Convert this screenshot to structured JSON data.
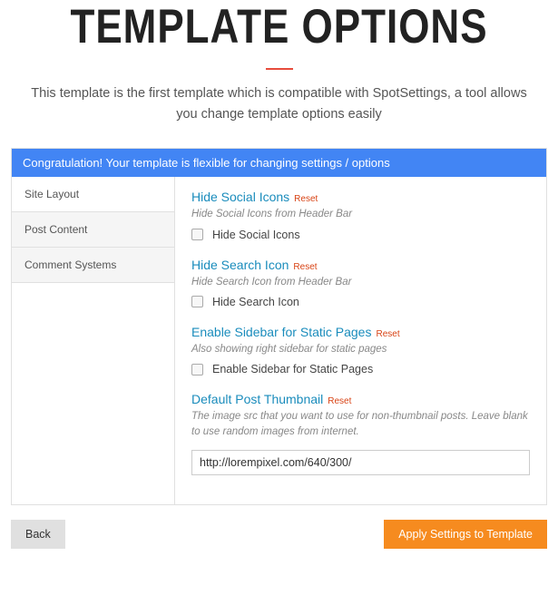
{
  "header": {
    "title": "TEMPLATE OPTIONS",
    "subtitle": "This template is the first template which is compatible with SpotSettings, a tool allows you change template options easily"
  },
  "banner": "Congratulation! Your template is flexible for changing settings / options",
  "sidebar": {
    "items": [
      {
        "label": "Site Layout",
        "active": true
      },
      {
        "label": "Post Content",
        "active": false
      },
      {
        "label": "Comment Systems",
        "active": false
      }
    ]
  },
  "sections": [
    {
      "title": "Hide Social Icons",
      "reset": "Reset",
      "desc": "Hide Social Icons from Header Bar",
      "checkbox_label": "Hide Social Icons"
    },
    {
      "title": "Hide Search Icon",
      "reset": "Reset",
      "desc": "Hide Search Icon from Header Bar",
      "checkbox_label": "Hide Search Icon"
    },
    {
      "title": "Enable Sidebar for Static Pages",
      "reset": "Reset",
      "desc": "Also showing right sidebar for static pages",
      "checkbox_label": "Enable Sidebar for Static Pages"
    },
    {
      "title": "Default Post Thumbnail",
      "reset": "Reset",
      "desc": "The image src that you want to use for non-thumbnail posts. Leave blank to use random images from internet.",
      "input_value": "http://lorempixel.com/640/300/"
    }
  ],
  "footer": {
    "back": "Back",
    "apply": "Apply Settings to Template"
  }
}
